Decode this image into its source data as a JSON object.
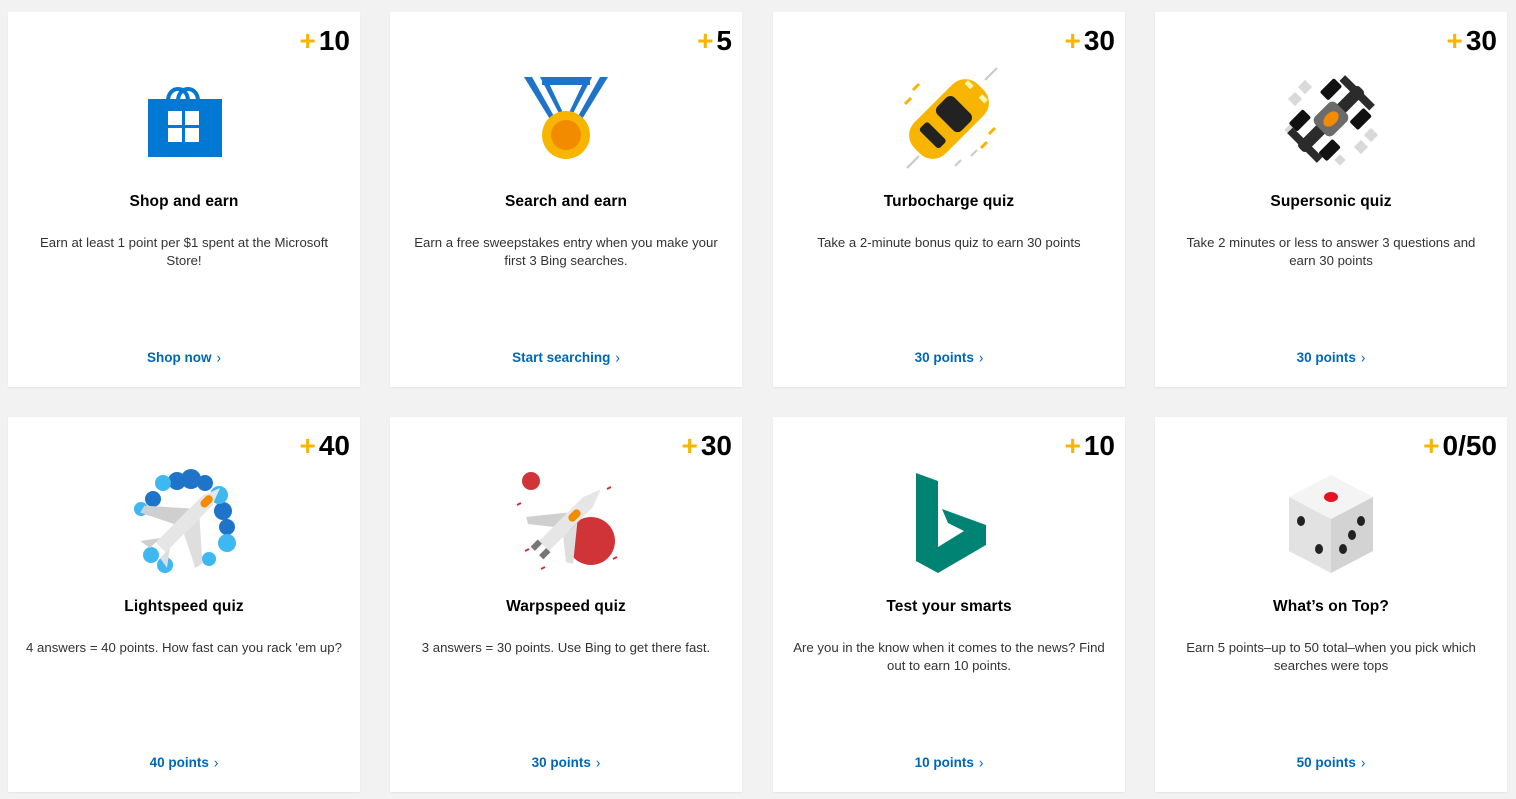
{
  "colors": {
    "accent_plus": "#f7b500",
    "link": "#0067b8",
    "background": "#f2f2f2",
    "card": "#ffffff"
  },
  "cards": [
    {
      "icon": "store-bag-icon",
      "badge_sign": "+",
      "badge_value": "10",
      "title": "Shop and earn",
      "description": "Earn at least 1 point per $1 spent at the Microsoft Store!",
      "link_label": "Shop now"
    },
    {
      "icon": "medal-icon",
      "badge_sign": "+",
      "badge_value": "5",
      "title": "Search and earn",
      "description": "Earn a free sweepstakes entry when you make your first 3 Bing searches.",
      "link_label": "Start searching"
    },
    {
      "icon": "race-car-icon",
      "badge_sign": "+",
      "badge_value": "30",
      "title": "Turbocharge quiz",
      "description": "Take a 2-minute bonus quiz to earn 30 points",
      "link_label": "30 points"
    },
    {
      "icon": "formula-car-icon",
      "badge_sign": "+",
      "badge_value": "30",
      "title": "Supersonic quiz",
      "description": "Take 2 minutes or less to answer 3 questions and earn 30 points",
      "link_label": "30 points"
    },
    {
      "icon": "jet-plane-icon",
      "badge_sign": "+",
      "badge_value": "40",
      "title": "Lightspeed quiz",
      "description": "4 answers = 40 points. How fast can you rack 'em up?",
      "link_label": "40 points"
    },
    {
      "icon": "spaceship-icon",
      "badge_sign": "+",
      "badge_value": "30",
      "title": "Warpspeed quiz",
      "description": "3 answers = 30 points. Use Bing to get there fast.",
      "link_label": "30 points"
    },
    {
      "icon": "bing-logo-icon",
      "badge_sign": "+",
      "badge_value": "10",
      "title": "Test your smarts",
      "description": "Are you in the know when it comes to the news? Find out to earn 10 points.",
      "link_label": "10 points"
    },
    {
      "icon": "dice-icon",
      "badge_sign": "+",
      "badge_value": "0/50",
      "title": "What’s on Top?",
      "description": "Earn 5 points–up to 50 total–when you pick which searches were tops",
      "link_label": "50 points"
    }
  ]
}
